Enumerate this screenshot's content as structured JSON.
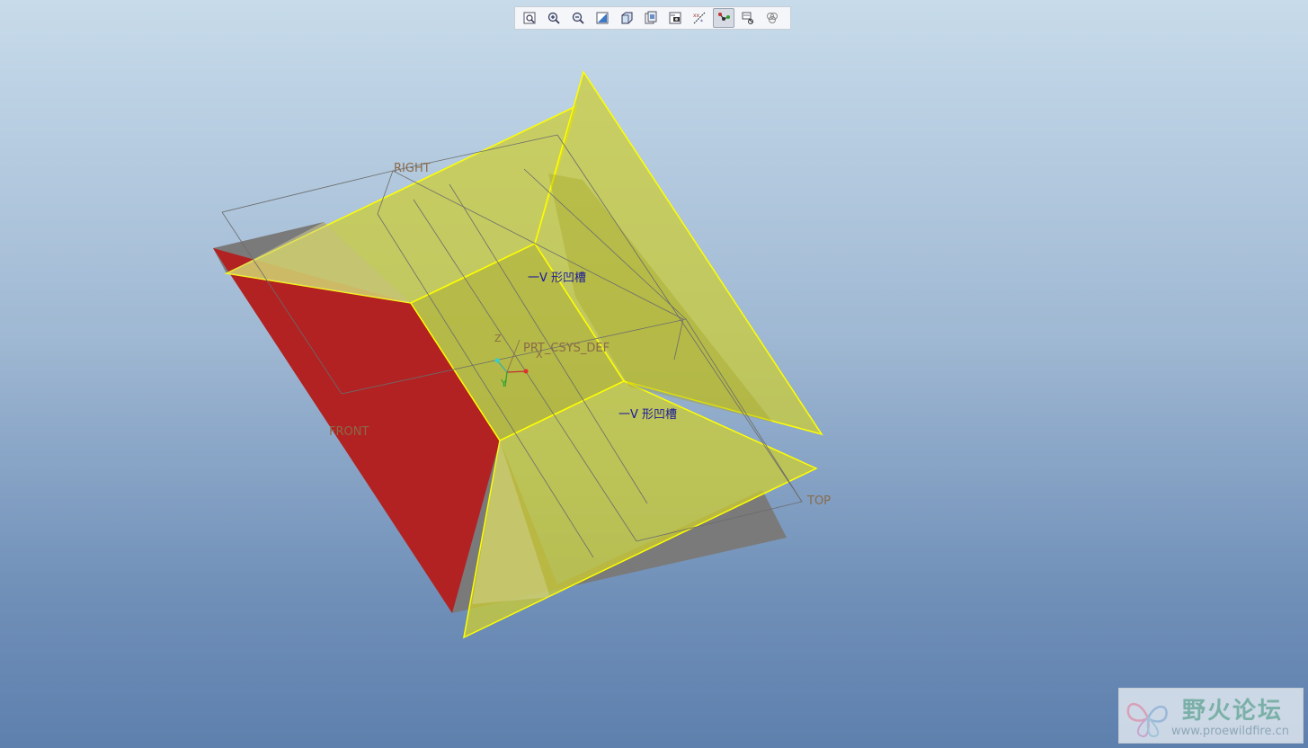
{
  "toolbar": {
    "buttons": [
      {
        "name": "refit-button",
        "icon": "refit-icon"
      },
      {
        "name": "zoom-in-button",
        "icon": "zoom-in-icon"
      },
      {
        "name": "zoom-out-button",
        "icon": "zoom-out-icon"
      },
      {
        "name": "repaint-button",
        "icon": "repaint-icon"
      },
      {
        "name": "display-style-button",
        "icon": "display-style-icon"
      },
      {
        "name": "saved-views-button",
        "icon": "saved-views-icon"
      },
      {
        "name": "view-manager-button",
        "icon": "view-manager-icon"
      },
      {
        "name": "datum-display-button",
        "icon": "datum-display-icon"
      },
      {
        "name": "spin-center-button",
        "icon": "spin-center-icon",
        "active": true
      },
      {
        "name": "annotation-display-button",
        "icon": "annotation-icon"
      },
      {
        "name": "appearance-button",
        "icon": "appearance-icon"
      }
    ]
  },
  "datums": {
    "right": "RIGHT",
    "front": "FRONT",
    "top": "TOP",
    "csys": "PRT_CSYS_DEF"
  },
  "axes": {
    "x": "X",
    "y": "Y",
    "z": "Z"
  },
  "features": {
    "label_1": "一V 形凹槽",
    "label_2": "一V 形凹槽"
  },
  "colors": {
    "surface_yellow": "#cccc30",
    "edge_yellow": "#ffff00",
    "red_face": "#b22222",
    "gray_face": "#7a7a7a",
    "datum_brown": "#8a6a4a",
    "feature_label_blue": "#1a1a9a"
  },
  "watermark": {
    "text": "野火论坛",
    "url": "www.proewildfire.cn"
  }
}
